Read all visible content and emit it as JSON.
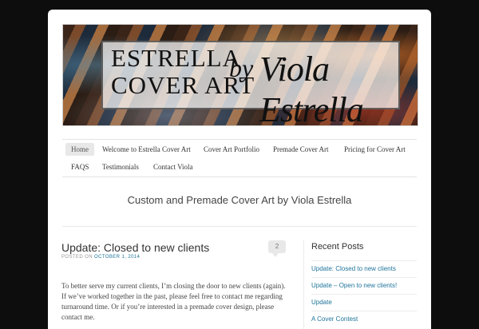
{
  "header": {
    "banner": {
      "line1": "ESTRELLA",
      "line2": "COVER ART",
      "by": "by",
      "signature": "Viola Estrella"
    }
  },
  "nav": {
    "items": [
      {
        "label": "Home",
        "active": true
      },
      {
        "label": "Welcome to Estrella Cover Art"
      },
      {
        "label": "Cover Art Portfolio"
      },
      {
        "label": "Premade Cover Art"
      },
      {
        "label": "Pricing for Cover Art"
      },
      {
        "label": "FAQS"
      },
      {
        "label": "Testimonials"
      },
      {
        "label": "Contact Viola"
      }
    ]
  },
  "site": {
    "tagline": "Custom and Premade Cover Art by Viola Estrella"
  },
  "post": {
    "title": "Update: Closed to new clients",
    "posted_on": "POSTED ON",
    "date": "OCTOBER 1, 2014",
    "comment_count": "2",
    "body": "To better serve my current clients, I’m closing the door to new clients (again). If we’ve worked together in the past, please feel free to contact me regarding turnaround time. Or if you’re interested in a premade cover design, please contact me."
  },
  "sidebar": {
    "recent_posts_title": "Recent Posts",
    "recent_posts": [
      "Update: Closed to new clients",
      "Update – Open to new clients!",
      "Update",
      "A Cover Contest"
    ]
  },
  "colors": {
    "link": "#21759b",
    "page_bg": "#0d0d0d"
  }
}
